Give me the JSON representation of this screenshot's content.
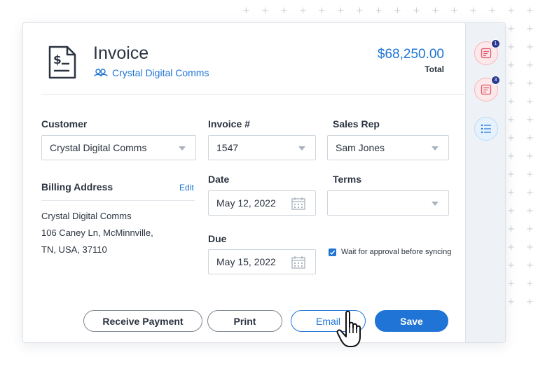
{
  "header": {
    "title": "Invoice",
    "customer_link": "Crystal Digital Comms",
    "amount": "$68,250.00",
    "amount_label": "Total"
  },
  "form": {
    "customer": {
      "label": "Customer",
      "value": "Crystal Digital Comms"
    },
    "invoice_number": {
      "label": "Invoice #",
      "value": "1547"
    },
    "sales_rep": {
      "label": "Sales Rep",
      "value": "Sam Jones"
    },
    "billing": {
      "label": "Billing Address",
      "edit_label": "Edit",
      "lines": [
        "Crystal Digital Comms",
        "106 Caney Ln, McMinnville,",
        "TN, USA, 37110"
      ]
    },
    "date": {
      "label": "Date",
      "value": "May 12, 2022"
    },
    "terms": {
      "label": "Terms",
      "value": ""
    },
    "due": {
      "label": "Due",
      "value": "May 15, 2022"
    },
    "wait_approval": {
      "label": "Wait for approval before syncing",
      "checked": true
    }
  },
  "actions": {
    "receive_payment": "Receive Payment",
    "print": "Print",
    "email": "Email",
    "save": "Save"
  },
  "sidebar": {
    "badges": [
      "1",
      "3"
    ]
  },
  "colors": {
    "accent": "#1f74d6",
    "text": "#2b3440",
    "badge": "#2b3a8f"
  }
}
